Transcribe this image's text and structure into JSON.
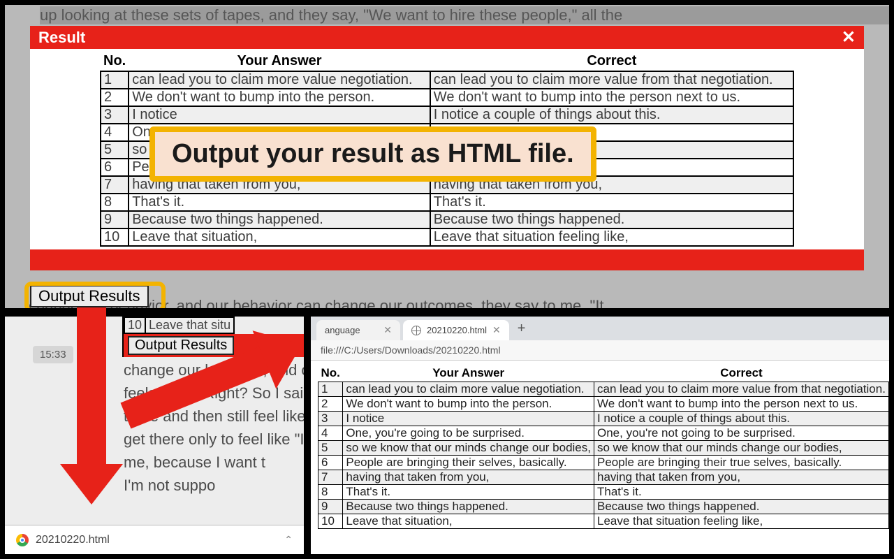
{
  "topBg1": "up looking at these sets of tapes, and they say, \"We want to hire these people,\" all the",
  "topBg2": "change our behavior, and our behavior can change our outcomes, they say to me, \"It",
  "modal": {
    "title": "Result",
    "headers": {
      "no": "No.",
      "your": "Your Answer",
      "correct": "Correct"
    },
    "rows": [
      {
        "n": "1",
        "your": "can lead you to claim more value negotiation.",
        "correct": "can lead you to claim more value from that negotiation."
      },
      {
        "n": "2",
        "your": "We don't want to bump into the person.",
        "correct": "We don't want to bump into the person next to us."
      },
      {
        "n": "3",
        "your": "I notice",
        "correct": "I notice a couple of things about this."
      },
      {
        "n": "4",
        "your": "One",
        "correct": ""
      },
      {
        "n": "5",
        "your": "so w",
        "correct": "s,"
      },
      {
        "n": "6",
        "your": "Peo",
        "correct": "y."
      },
      {
        "n": "7",
        "your": "having that taken from you,",
        "correct": "having that taken from you,"
      },
      {
        "n": "8",
        "your": "That's it.",
        "correct": "That's it."
      },
      {
        "n": "9",
        "your": "Because two things happened.",
        "correct": "Because two things happened."
      },
      {
        "n": "10",
        "your": "Leave that situation,",
        "correct": "Leave that situation feeling like,"
      }
    ],
    "outputBtn": "Output Results"
  },
  "callout": "Output your result as HTML file.",
  "bl": {
    "time": "15:33",
    "miniRow": {
      "n": "10",
      "text": "Leave that situ"
    },
    "outputBtn": "Output Results",
    "line1": "change our behavior, and ou",
    "line2": "feels fake.\" Right? So I said",
    "line3": "there and then still feel like a",
    "line4": "get there only to feel like \"I'm",
    "line5": "me, because I want t",
    "line6": "I'm not suppo",
    "downloadFilename": "20210220.html"
  },
  "br": {
    "tab0": "anguage",
    "tab1": "20210220.html",
    "url": "file:///C:/Users/Downloads/20210220.html",
    "headers": {
      "no": "No.",
      "your": "Your Answer",
      "correct": "Correct"
    },
    "rows": [
      {
        "n": "1",
        "your": "can lead you to claim more value negotiation.",
        "correct": "can lead you to claim more value from that negotiation."
      },
      {
        "n": "2",
        "your": "We don't want to bump into the person.",
        "correct": "We don't want to bump into the person next to us."
      },
      {
        "n": "3",
        "your": "I notice",
        "correct": "I notice a couple of things about this."
      },
      {
        "n": "4",
        "your": "One, you're going to be surprised.",
        "correct": "One, you're not going to be surprised."
      },
      {
        "n": "5",
        "your": "so we know that our minds change our bodies,",
        "correct": "so we know that our minds change our bodies,"
      },
      {
        "n": "6",
        "your": "People are bringing their selves, basically.",
        "correct": "People are bringing their true selves, basically."
      },
      {
        "n": "7",
        "your": "having that taken from you,",
        "correct": "having that taken from you,"
      },
      {
        "n": "8",
        "your": "That's it.",
        "correct": "That's it."
      },
      {
        "n": "9",
        "your": "Because two things happened.",
        "correct": "Because two things happened."
      },
      {
        "n": "10",
        "your": "Leave that situation,",
        "correct": "Leave that situation feeling like,"
      }
    ]
  }
}
